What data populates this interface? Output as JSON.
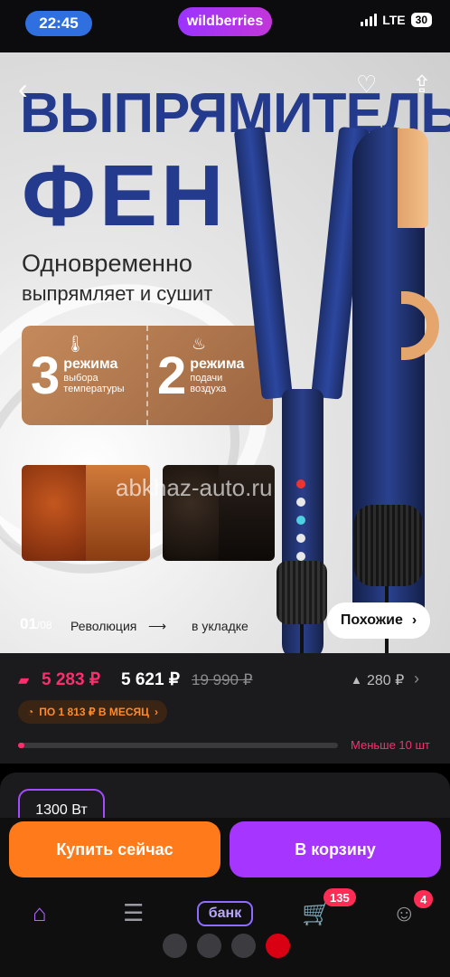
{
  "status_bar": {
    "time": "22:45",
    "brand": "wildberries",
    "network": "LTE",
    "battery": "30"
  },
  "hero": {
    "title_line1": "ВЫПРЯМИТЕЛЬ",
    "title_line2": "ФЕН",
    "subtitle_line1": "Одновременно",
    "subtitle_line2": "выпрямляет и сушит",
    "modes": [
      {
        "count": "3",
        "label": "режима",
        "desc_line1": "выбора",
        "desc_line2": "температуры"
      },
      {
        "count": "2",
        "label": "режима",
        "desc_line1": "подачи",
        "desc_line2": "воздуха"
      }
    ],
    "pager": "01",
    "pager_total": "/08",
    "caption_from": "Революция",
    "caption_arrow": "⟶",
    "caption_to": "в укладке",
    "similar_label": "Похожие",
    "watermark": "abkhaz-auto.ru"
  },
  "price": {
    "current": "5 283 ₽",
    "alt": "5 621 ₽",
    "old": "19 990 ₽",
    "rise": "280 ₽",
    "installment": "ПО 1 813 ₽ В МЕСЯЦ",
    "stock": "Меньше 10 шт",
    "stock_level_pct": 2
  },
  "options": {
    "selected": "1300 Вт"
  },
  "actions": {
    "buy_now": "Купить сейчас",
    "add_to_cart": "В корзину"
  },
  "tabbar": {
    "bank": "банк",
    "cart_badge": "135",
    "profile_badge": "4"
  },
  "colors": {
    "accent_pink": "#ff2d6e",
    "buy_orange": "#ff7a1a",
    "cart_purple": "#a535ff",
    "title_blue": "#243a8c"
  }
}
